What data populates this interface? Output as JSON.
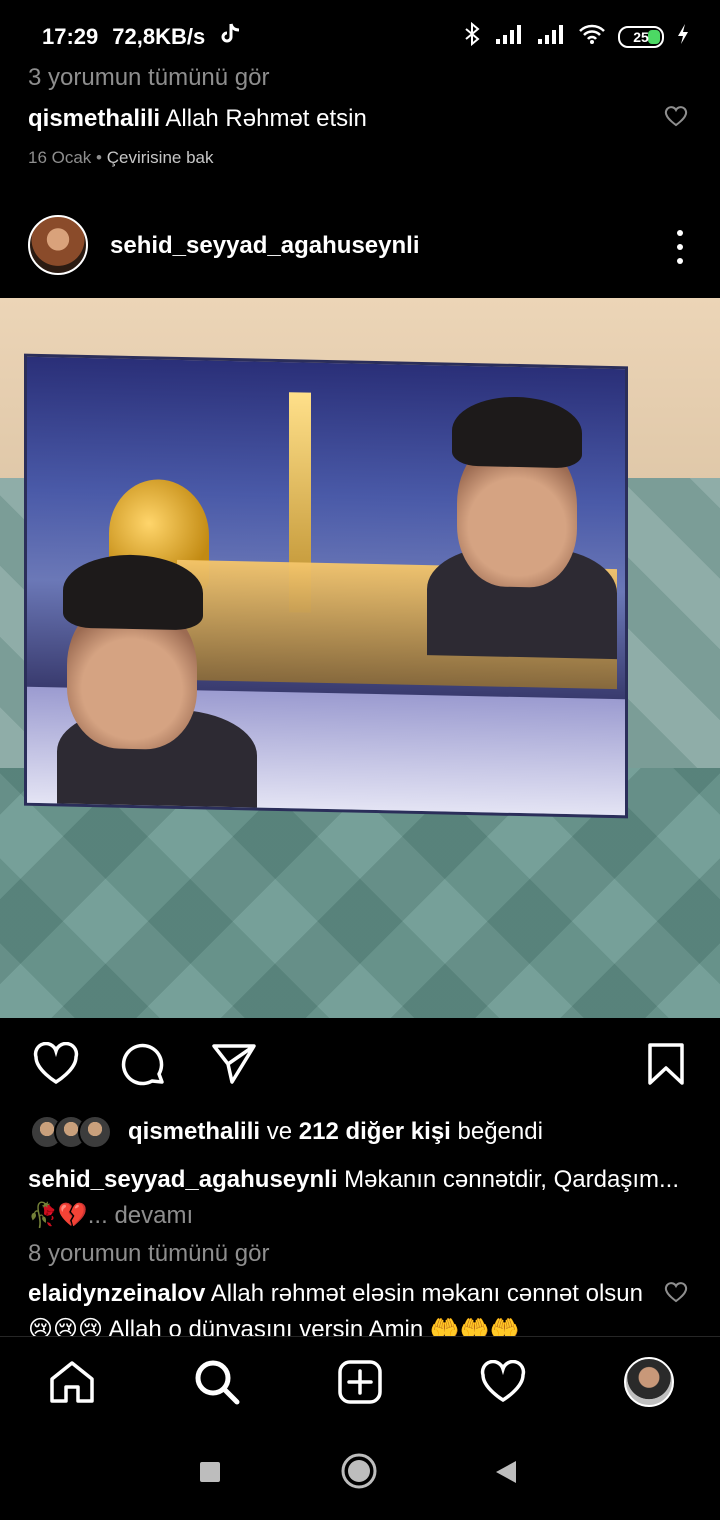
{
  "status_bar": {
    "time": "17:29",
    "speed": "72,8KB/s",
    "battery": "25",
    "icons": [
      "tiktok-icon",
      "bluetooth-icon",
      "signal-icon",
      "signal-icon",
      "wifi-icon",
      "battery-icon",
      "charging-icon"
    ]
  },
  "previous_post": {
    "view_all": "3 yorumun tümünü gör",
    "comment_user": "qismethalili",
    "comment_text": "Allah Rəhmət etsin",
    "date": "16 Ocak",
    "separator": "•",
    "translate": "Çevirisine bak"
  },
  "post": {
    "username": "sehid_seyyad_agahuseynli",
    "liked_by_user": "qismethalili",
    "liked_and": "ve",
    "liked_count": "212 diğer kişi",
    "liked_suffix": "beğendi",
    "caption_user": "sehid_seyyad_agahuseynli",
    "caption_text": "Məkanın cənnətdir, Qardaşım...",
    "caption_emoji": "🥀💔",
    "caption_more": "... devamı",
    "view_all_comments": "8 yorumun tümünü gör",
    "comment_user": "elaidynzeinalov",
    "comment_text": "Allah rəhmət eləsin məkanı cənnət olsun 😢😢😢 Allah o dünyasını versin Amin 🤲🤲🤲"
  },
  "colors": {
    "background": "#000000",
    "muted_text": "#8e8e8e",
    "battery_fill": "#4cd964"
  }
}
